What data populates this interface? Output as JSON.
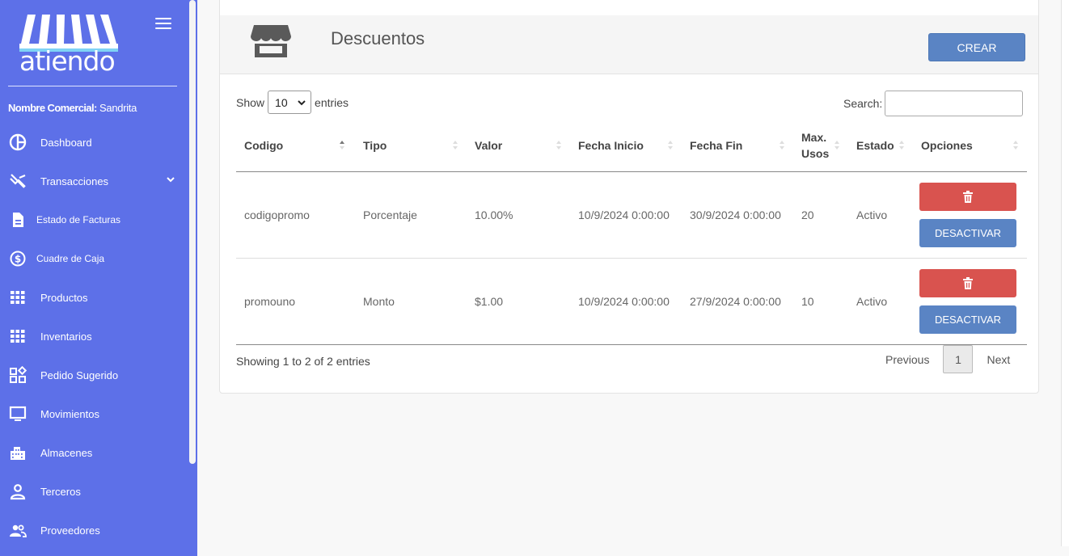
{
  "sidebar": {
    "logo_text": "atiendo",
    "merchant_label": "Nombre Comercial:",
    "merchant_name": "Sandrita",
    "items": [
      {
        "label": "Dashboard"
      },
      {
        "label": "Transacciones"
      },
      {
        "label": "Estado de Facturas"
      },
      {
        "label": "Cuadre de Caja"
      },
      {
        "label": "Productos"
      },
      {
        "label": "Inventarios"
      },
      {
        "label": "Pedido Sugerido"
      },
      {
        "label": "Movimientos"
      },
      {
        "label": "Almacenes"
      },
      {
        "label": "Terceros"
      },
      {
        "label": "Proveedores"
      }
    ]
  },
  "page": {
    "title": "Descuentos",
    "create_label": "CREAR"
  },
  "table_controls": {
    "show_label": "Show",
    "entries_label": "entries",
    "page_size": "10",
    "search_label": "Search:",
    "search_value": ""
  },
  "table": {
    "headers": [
      "Codigo",
      "Tipo",
      "Valor",
      "Fecha Inicio",
      "Fecha Fin",
      "Max. Usos",
      "Estado",
      "Opciones"
    ],
    "rows": [
      {
        "codigo": "codigopromo",
        "tipo": "Porcentaje",
        "valor": "10.00%",
        "inicio": "10/9/2024 0:00:00",
        "fin": "30/9/2024 0:00:00",
        "max": "20",
        "estado": "Activo",
        "deactivate_label": "DESACTIVAR"
      },
      {
        "codigo": "promouno",
        "tipo": "Monto",
        "valor": "$1.00",
        "inicio": "10/9/2024 0:00:00",
        "fin": "27/9/2024 0:00:00",
        "max": "10",
        "estado": "Activo",
        "deactivate_label": "DESACTIVAR"
      }
    ]
  },
  "footer": {
    "info": "Showing 1 to 2 of 2 entries",
    "previous": "Previous",
    "page": "1",
    "next": "Next"
  },
  "colors": {
    "sidebar": "#5d70e8",
    "primary_button": "#5a84c4",
    "danger_button": "#d9534f"
  }
}
